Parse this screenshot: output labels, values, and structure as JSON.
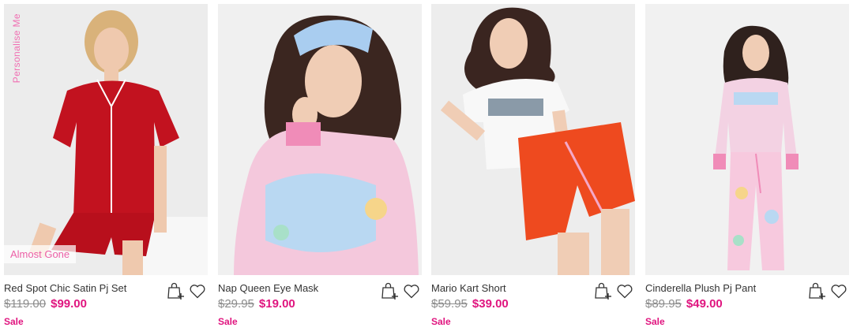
{
  "products": [
    {
      "name": "Red Spot Chic Satin Pj Set",
      "was_price": "$119.00",
      "now_price": "$99.00",
      "sale_label": "Sale",
      "badge": "Almost Gone",
      "side_label": "Personalise Me",
      "image_bg": "#ededed",
      "garment": "#c2121f"
    },
    {
      "name": "Nap Queen Eye Mask",
      "was_price": "$29.95",
      "now_price": "$19.00",
      "sale_label": "Sale",
      "image_bg": "#f1f1f1",
      "garment": "#f4c8dc"
    },
    {
      "name": "Mario Kart Short",
      "was_price": "$59.95",
      "now_price": "$39.00",
      "sale_label": "Sale",
      "image_bg": "#eeeeee",
      "garment": "#ee4a1f"
    },
    {
      "name": "Cinderella Plush Pj Pant",
      "was_price": "$89.95",
      "now_price": "$49.00",
      "sale_label": "Sale",
      "image_bg": "#f2f2f2",
      "garment": "#f7c9de"
    }
  ],
  "icons": {
    "add_to_bag": "shopping-bag-plus-icon",
    "wishlist": "heart-icon"
  },
  "colors": {
    "sale": "#e0157f",
    "strike": "#8c8c8c",
    "badge_text": "#ec5fa6"
  }
}
